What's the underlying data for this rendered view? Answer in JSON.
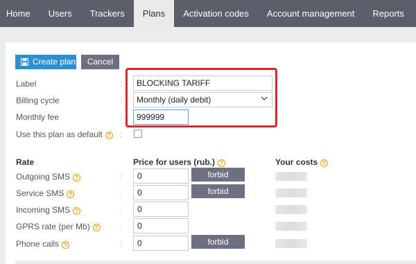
{
  "nav": {
    "items": [
      "Home",
      "Users",
      "Trackers",
      "Plans",
      "Activation codes",
      "Account management",
      "Reports"
    ],
    "active": "Plans"
  },
  "toolbar": {
    "create_label": "Create plan",
    "cancel_label": "Cancel"
  },
  "form": {
    "label_label": "Label",
    "label_value": "BLOCKING TARIFF",
    "billing_label": "Billing cycle",
    "billing_value": "Monthly (daily debit)",
    "fee_label": "Monthly fee",
    "fee_value": "999999",
    "default_label": "Use this plan as default",
    "colon": ":"
  },
  "rates": {
    "col_rate": "Rate",
    "col_price": "Price for users (rub.)",
    "col_costs": "Your costs",
    "forbid_label": "forbid",
    "rows": [
      {
        "label": "Outgoing SMS",
        "value": "0",
        "forbid": true
      },
      {
        "label": "Service SMS",
        "value": "0",
        "forbid": true
      },
      {
        "label": "Incoming SMS",
        "value": "0",
        "forbid": false
      },
      {
        "label": "GPRS rate (per Mb)",
        "value": "0",
        "forbid": false
      },
      {
        "label": "Phone calls",
        "value": "0",
        "forbid": true
      }
    ]
  },
  "colors": {
    "nav_bg": "#5b5f6b",
    "primary": "#2b8fd1",
    "secondary": "#6c7080",
    "highlight": "#e02323",
    "help": "#e8a200"
  },
  "icons": {
    "create": "save-icon",
    "billing": "chevron-down-icon",
    "help": "help-icon"
  }
}
